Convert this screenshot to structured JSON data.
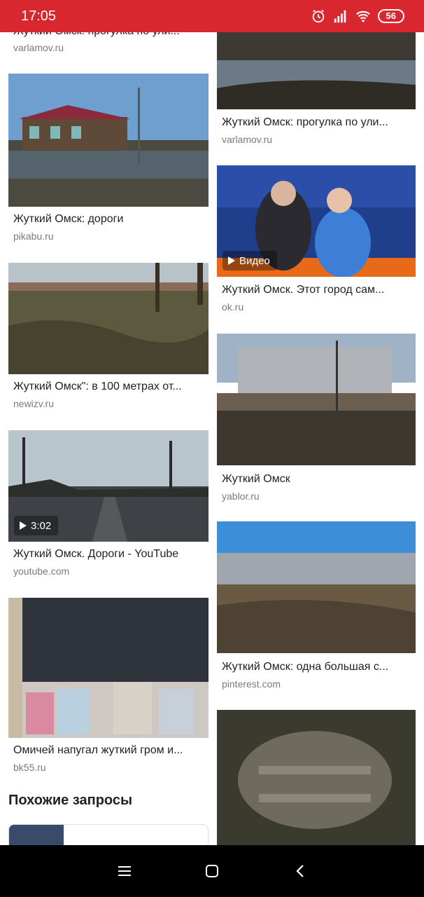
{
  "status_bar": {
    "time": "17:05",
    "battery": "56"
  },
  "results_left": [
    {
      "title": "Жуткий Омск: прогулка по ули...",
      "source": "varlamov.ru"
    },
    {
      "title": "Жуткий Омск: дороги",
      "source": "pikabu.ru"
    },
    {
      "title": "Жуткий Омск\": в 100 метрах от...",
      "source": "newizv.ru"
    },
    {
      "title": "Жуткий Омск. Дороги - YouTube",
      "source": "youtube.com",
      "badge": "3:02"
    },
    {
      "title": "Омичей напугал жуткий гром и...",
      "source": "bk55.ru"
    }
  ],
  "results_right": [
    {
      "title": "Жуткий Омск: прогулка по ули...",
      "source": "varlamov.ru"
    },
    {
      "title": "Жуткий Омск. Этот город сам...",
      "source": "ok.ru",
      "badge": "Видео"
    },
    {
      "title": "Жуткий Омск",
      "source": "yablor.ru"
    },
    {
      "title": "Жуткий Омск: одна большая с...",
      "source": "pinterest.com"
    }
  ],
  "related": {
    "heading": "Похожие запросы"
  },
  "colors": {
    "accent": "#d8272f",
    "source_text": "#7a7a7a"
  },
  "nav_icons": [
    "menu-icon",
    "home-icon",
    "back-icon"
  ]
}
